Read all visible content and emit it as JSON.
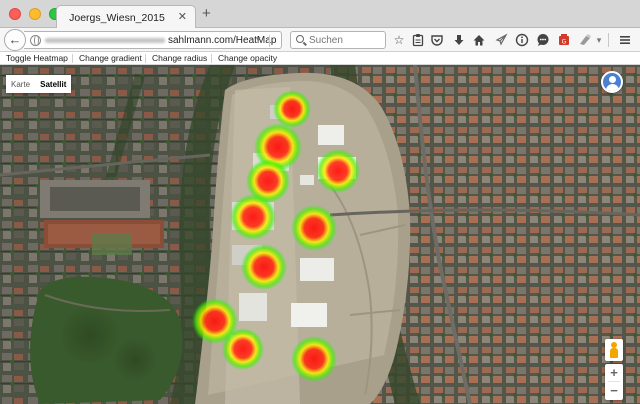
{
  "tab": {
    "title": "Joergs_Wiesn_2015",
    "close": "✕",
    "new_tab": "+"
  },
  "nav": {
    "back": "←",
    "url_visible": "sahlmann.com/HeatMap",
    "url_dropdown": "▾",
    "reload": "↻",
    "search_placeholder": "Suchen"
  },
  "toolbar_icons": [
    "star-icon",
    "clipboard-icon",
    "pocket-icon",
    "download-icon",
    "home-icon",
    "rocket-icon",
    "info-icon",
    "chat-icon",
    "extension-red-icon",
    "extension-gray-icon",
    "hamburger-menu-icon"
  ],
  "page_links": [
    "Toggle Heatmap",
    "Change gradient",
    "Change radius",
    "Change opacity"
  ],
  "map": {
    "type_options": [
      "Karte",
      "Satellit"
    ],
    "selected_type": "Satellit",
    "zoom_in": "+",
    "zoom_out": "−",
    "heatmap_gradient": [
      "#00ff00",
      "#ffff00",
      "#ff0000"
    ]
  }
}
